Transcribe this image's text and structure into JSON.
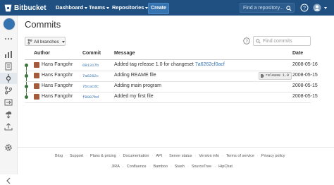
{
  "header": {
    "brand": "Bitbucket",
    "nav": [
      "Dashboard",
      "Teams",
      "Repositories"
    ],
    "create_label": "Create",
    "search_placeholder": "Find a repository..."
  },
  "page": {
    "title": "Commits",
    "branch_filter": "All branches",
    "find_placeholder": "Find commits"
  },
  "table": {
    "columns": [
      "Author",
      "Commit",
      "Message",
      "Date"
    ],
    "rows": [
      {
        "author": "Hans Fangohr",
        "commit": "691317b",
        "message": "Added tag release 1.0 for changeset ",
        "message_link": "7a6262cf0acf",
        "tag": "",
        "date": "2008-05-16"
      },
      {
        "author": "Hans Fangohr",
        "commit": "7a6262c",
        "message": "Adding REAME file",
        "message_link": "",
        "tag": "release 1.0",
        "date": "2008-05-15"
      },
      {
        "author": "Hans Fangohr",
        "commit": "7bcacdc",
        "message": "Adding main program",
        "message_link": "",
        "tag": "",
        "date": "2008-05-15"
      },
      {
        "author": "Hans Fangohr",
        "commit": "f8087bd",
        "message": "Added my first file",
        "message_link": "",
        "tag": "",
        "date": "2008-05-15"
      }
    ]
  },
  "footer": {
    "row1": [
      "Blog",
      "Support",
      "Plans & pricing",
      "Documentation",
      "API",
      "Server status",
      "Version info",
      "Terms of service",
      "Privacy policy"
    ],
    "row2": [
      "JIRA",
      "Confluence",
      "Bamboo",
      "Stash",
      "SourceTree",
      "HipChat"
    ]
  },
  "colors": {
    "topbar": "#205081",
    "link": "#3572b0",
    "graph": "#3c763d"
  }
}
